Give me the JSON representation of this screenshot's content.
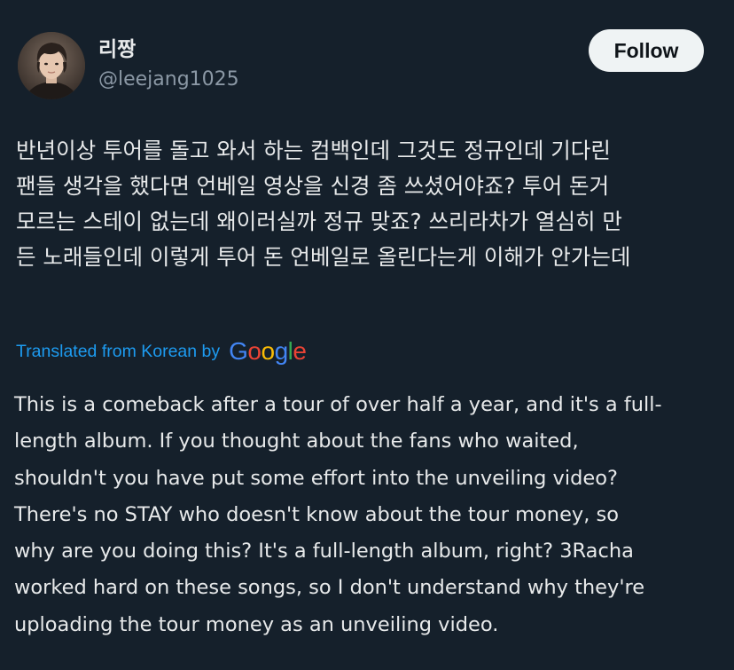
{
  "user": {
    "display_name": "리짱",
    "handle": "@leejang1025",
    "avatar_icon": "profile-photo"
  },
  "actions": {
    "follow_label": "Follow"
  },
  "tweet": {
    "original_lines": [
      "반년이상 투어를 돌고 와서 하는 컴백인데 그것도 정규인데 기다린",
      "팬들 생각을 했다면 언베일 영상을 신경 좀 쓰셨어야죠? 투어 돈거",
      "모르는 스테이 없는데 왜이러실까 정규 맞죠? 쓰리라차가 열심히 만",
      "든 노래들인데 이렇게 투어 돈 언베일로 올린다는게 이해가 안가는데"
    ],
    "translation_label": "Translated from Korean by",
    "translation_provider": {
      "letters": [
        "G",
        "o",
        "o",
        "g",
        "l",
        "e"
      ],
      "colors": [
        "#4285f4",
        "#ea4335",
        "#fbbc05",
        "#4285f4",
        "#34a853",
        "#ea4335"
      ]
    },
    "translated_lines": [
      "This is a comeback after a tour of over half a year, and it's a full-",
      "length album. If you thought about the fans who waited,",
      "shouldn't you have put some effort into the unveiling video?",
      "There's no STAY who doesn't know about the tour money, so",
      "why are you doing this? It's a full-length album, right? 3Racha",
      "worked hard on these songs, so I don't understand why they're",
      "uploading the tour money as an unveiling video."
    ]
  },
  "colors": {
    "background": "#15202b",
    "text_primary": "#e7e9ea",
    "text_secondary": "#8b98a5",
    "link": "#1d9bf0",
    "follow_bg": "#eff3f4"
  }
}
